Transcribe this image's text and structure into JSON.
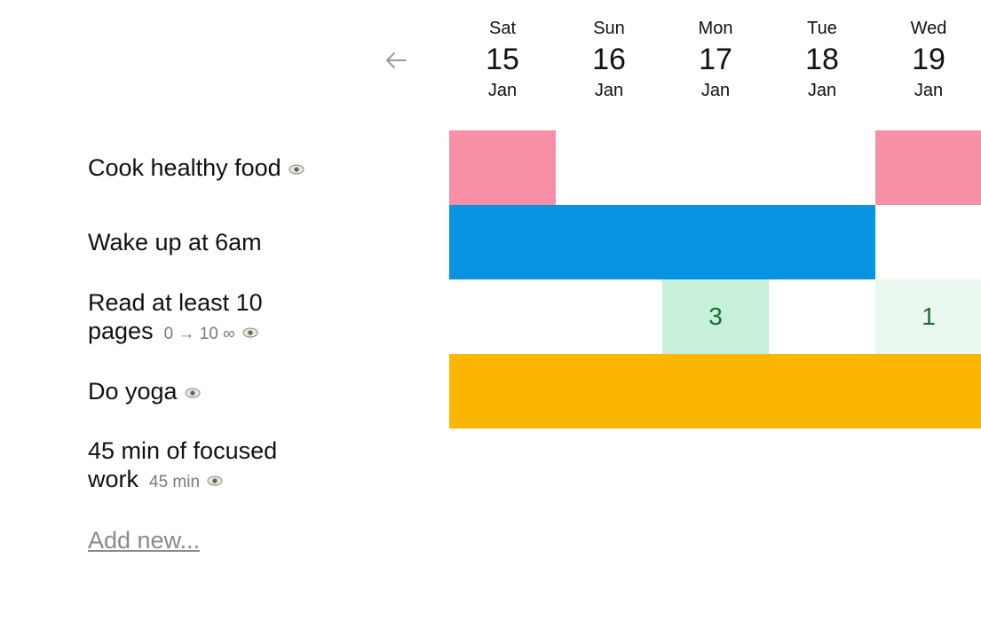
{
  "header": {
    "days": [
      {
        "weekday": "Sat",
        "day": "15",
        "month": "Jan"
      },
      {
        "weekday": "Sun",
        "day": "16",
        "month": "Jan"
      },
      {
        "weekday": "Mon",
        "day": "17",
        "month": "Jan"
      },
      {
        "weekday": "Tue",
        "day": "18",
        "month": "Jan"
      },
      {
        "weekday": "Wed",
        "day": "19",
        "month": "Jan"
      }
    ]
  },
  "habits": [
    {
      "name": "Cook healthy food",
      "meta": "",
      "color": "#f78fa7",
      "cells": [
        {
          "state": "done",
          "value": ""
        },
        {
          "state": "empty",
          "value": ""
        },
        {
          "state": "empty",
          "value": ""
        },
        {
          "state": "empty",
          "value": ""
        },
        {
          "state": "done",
          "value": ""
        }
      ]
    },
    {
      "name": "Wake up at 6am",
      "meta": "",
      "color": "#0894e2",
      "cells": [
        {
          "state": "done",
          "value": ""
        },
        {
          "state": "done",
          "value": ""
        },
        {
          "state": "done",
          "value": ""
        },
        {
          "state": "done",
          "value": ""
        },
        {
          "state": "empty",
          "value": ""
        }
      ]
    },
    {
      "name": "Read at least 10 pages",
      "meta": "0 → 10 ∞",
      "color": "#c6f0d9",
      "cells": [
        {
          "state": "empty",
          "value": ""
        },
        {
          "state": "empty",
          "value": ""
        },
        {
          "state": "partial",
          "value": "3"
        },
        {
          "state": "empty",
          "value": ""
        },
        {
          "state": "partial-light",
          "value": "1"
        }
      ]
    },
    {
      "name": "Do yoga",
      "meta": "",
      "color": "#fbb600",
      "cells": [
        {
          "state": "done",
          "value": ""
        },
        {
          "state": "done",
          "value": ""
        },
        {
          "state": "done",
          "value": ""
        },
        {
          "state": "done",
          "value": ""
        },
        {
          "state": "done",
          "value": ""
        }
      ]
    },
    {
      "name": "45 min of focused work",
      "meta": "45 min",
      "color": "#ffffff",
      "cells": [
        {
          "state": "empty",
          "value": ""
        },
        {
          "state": "empty",
          "value": ""
        },
        {
          "state": "empty",
          "value": ""
        },
        {
          "state": "empty",
          "value": ""
        },
        {
          "state": "empty",
          "value": ""
        }
      ]
    }
  ],
  "add_new_label": "Add new...",
  "colors": {
    "partial_light": "#eaf9ef",
    "partial_text": "#1e6b32",
    "muted_text": "#7a7a7a"
  },
  "icons": {
    "back": "arrow-left-icon",
    "visibility": "eye-icon"
  }
}
